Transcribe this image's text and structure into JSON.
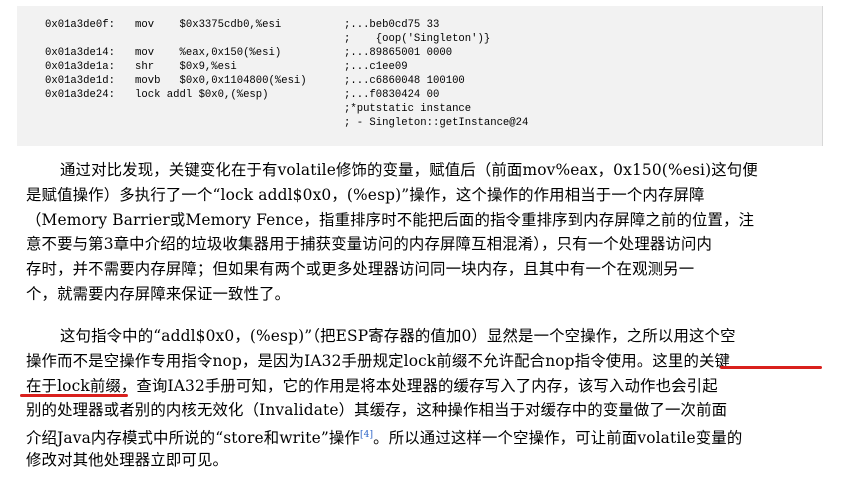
{
  "code": {
    "lines": [
      {
        "addr": "0x01a3de0f:",
        "ins": "mov    $0x3375cdb0,%esi",
        "cmt": ";...beb0cd75 33"
      },
      {
        "addr": "",
        "ins": "",
        "cmt": ";    {oop('Singleton')}"
      },
      {
        "addr": "0x01a3de14:",
        "ins": "mov    %eax,0x150(%esi)",
        "cmt": ";...89865001 0000"
      },
      {
        "addr": "0x01a3de1a:",
        "ins": "shr    $0x9,%esi",
        "cmt": ";...c1ee09"
      },
      {
        "addr": "0x01a3de1d:",
        "ins": "movb   $0x0,0x1104800(%esi)",
        "cmt": ";...c6860048 100100"
      },
      {
        "addr": "0x01a3de24:",
        "ins": "lock addl $0x0,(%esp)",
        "cmt": ";...f0830424 00"
      },
      {
        "addr": "",
        "ins": "",
        "cmt": ";*putstatic instance"
      },
      {
        "addr": "",
        "ins": "",
        "cmt": "; - Singleton::getInstance@24"
      }
    ]
  },
  "paragraph1": [
    "通过对比发现，关键变化在于有volatile修饰的变量，赋值后（前面mov%eax，0x150(%esi)这句便",
    "是赋值操作）多执行了一个“lock addl$0x0，(%esp)”操作，这个操作的作用相当于一个内存屏障",
    "（Memory Barrier或Memory Fence，指重排序时不能把后面的指令重排序到内存屏障之前的位置，注",
    "意不要与第3章中介绍的垃圾收集器用于捕获变量访问的内存屏障互相混淆），只有一个处理器访问内",
    "存时，并不需要内存屏障；但如果有两个或更多处理器访问同一块内存，且其中有一个在观测另一",
    "个，就需要内存屏障来保证一致性了。"
  ],
  "paragraph2": {
    "line1": "这句指令中的“addl$0x0，(%esp)”（把ESP寄存器的值加0）显然是一个空操作，之所以用这个空",
    "line2": "操作而不是空操作专用指令nop，是因为IA32手册规定lock前缀不允许配合nop指令使用。这里的关键",
    "line3": "在于lock前缀，查询IA32手册可知，它的作用是将本处理器的缓存写入了内存，该写入动作也会引起",
    "line4": "别的处理器或者别的内核无效化（Invalidate）其缓存，这种操作相当于对缓存中的变量做了一次前面",
    "line5_before": "介绍Java内存模式中所说的“store和write”操作",
    "line5_ref": "[4]",
    "line5_after": "。所以通过这样一个空操作，可让前面volatile变量的",
    "line6": "修改对其他处理器立即可见。"
  },
  "colors": {
    "underline": "#d9201d",
    "code_background": "#f2f2f2",
    "reference_link": "#2a63c7"
  }
}
